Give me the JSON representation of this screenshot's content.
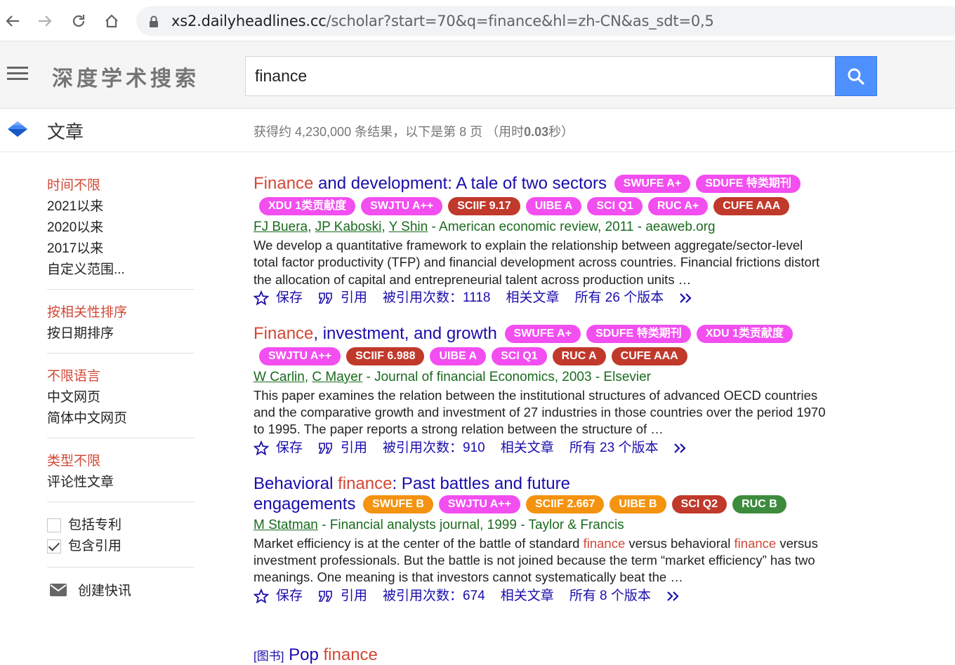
{
  "browser": {
    "url_host": "xs2.dailyheadlines.cc",
    "url_path": "/scholar?start=70&q=finance&hl=zh-CN&as_sdt=0,5"
  },
  "header": {
    "brand": "深度学术搜索",
    "search_value": "finance",
    "search_button_color": "#4d90fe"
  },
  "subheader": {
    "section_title": "文章",
    "stats_prefix": "获得约 4,230,000 条结果，以下是第 8 页 （用时",
    "stats_time": "0.03",
    "stats_suffix": "秒）"
  },
  "sidebar": {
    "time": [
      "时间不限",
      "2021以来",
      "2020以来",
      "2017以来",
      "自定义范围..."
    ],
    "sort": [
      "按相关性排序",
      "按日期排序"
    ],
    "lang": [
      "不限语言",
      "中文网页",
      "简体中文网页"
    ],
    "type": [
      "类型不限",
      "评论性文章"
    ],
    "include_patents": "包括专利",
    "include_citations": "包含引用",
    "create_alert": "创建快讯"
  },
  "colors": {
    "highlight": "#d14836",
    "link": "#1a0dab",
    "meta": "#1a6b1e",
    "badge_pink": "#f24ef0",
    "badge_red": "#c0392b",
    "badge_orange": "#f4930f",
    "badge_green": "#3d8b3d"
  },
  "results": [
    {
      "title_hl": "Finance",
      "title_rest": " and development: A tale of two sectors",
      "badges_row1": [
        "SWUFE A+",
        "SDUFE 特类期刊"
      ],
      "badges_row2": [
        "XDU 1类贡献度",
        "SWJTU A++",
        "SCIIF 9.17",
        "UIBE A",
        "SCI Q1",
        "RUC A+",
        "CUFE AAA"
      ],
      "authors": [
        "FJ Buera",
        "JP Kaboski",
        "Y Shin"
      ],
      "venue": " - American economic review, 2011 - aeaweb.org",
      "snippet": "We develop a quantitative framework to explain the relationship between aggregate/sector-level total factor productivity (TFP) and financial development across countries. Financial frictions distort the allocation of capital and entrepreneurial talent across production units …",
      "save": "保存",
      "cite": "引用",
      "cited_by": "被引用次数：1118",
      "related": "相关文章",
      "versions": "所有 26 个版本"
    },
    {
      "title_hl": "Finance",
      "title_rest": ", investment, and growth",
      "badges_row1": [
        "SWUFE A+",
        "SDUFE 特类期刊",
        "XDU 1类贡献度"
      ],
      "badges_row2": [
        "SWJTU A++",
        "SCIIF 6.988",
        "UIBE A",
        "SCI Q1",
        "RUC A",
        "CUFE AAA"
      ],
      "authors": [
        "W Carlin",
        "C Mayer"
      ],
      "venue": " - Journal of financial Economics, 2003 - Elsevier",
      "snippet": "This paper examines the relation between the institutional structures of advanced OECD countries and the comparative growth and investment of 27 industries in those countries over the period 1970 to 1995. The paper reports a strong relation between the structure of …",
      "save": "保存",
      "cite": "引用",
      "cited_by": "被引用次数：910",
      "related": "相关文章",
      "versions": "所有 23 个版本"
    },
    {
      "title_pre": "Behavioral ",
      "title_hl": "finance",
      "title_rest": ": Past battles and future",
      "title_line2": "engagements",
      "badges_row2": [
        "SWUFE B",
        "SWJTU A++",
        "SCIIF 2.667",
        "UIBE B",
        "SCI Q2",
        "RUC B"
      ],
      "authors": [
        "M Statman"
      ],
      "venue": " - Financial analysts journal, 1999 - Taylor & Francis",
      "snippet_a": "Market efficiency is at the center of the battle of standard ",
      "snippet_hl1": "finance",
      "snippet_b": " versus behavioral ",
      "snippet_hl2": "finance",
      "snippet_c": " versus investment professionals. But the battle is not joined because the term “market efficiency” has two meanings. One meaning is that investors cannot systematically beat the …",
      "save": "保存",
      "cite": "引用",
      "cited_by": "被引用次数：674",
      "related": "相关文章",
      "versions": "所有 8 个版本"
    }
  ],
  "partial_result": {
    "prefix": "[图书]",
    "title_pre": "Pop ",
    "title_hl": "finance"
  }
}
